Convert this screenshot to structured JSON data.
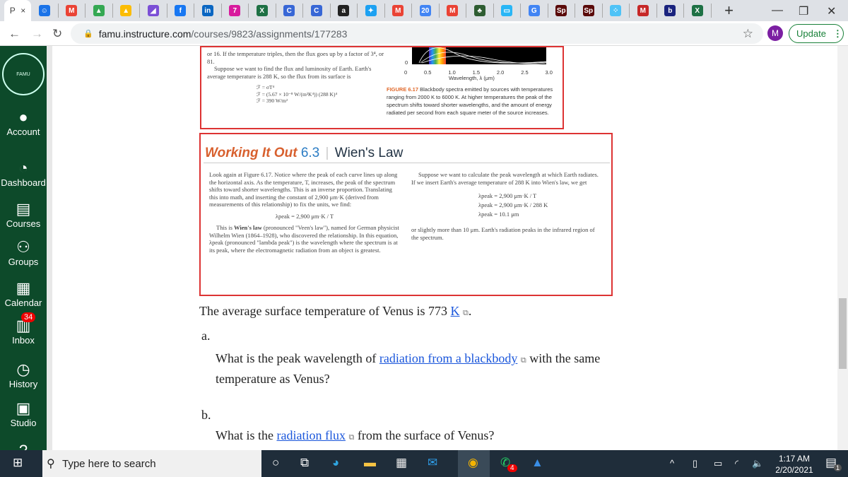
{
  "browser": {
    "active_tab": {
      "label": "P",
      "close": "×"
    },
    "tab_favicons": [
      {
        "icon": "meet-icon",
        "glyph": "☺",
        "color": "#1a73e8"
      },
      {
        "icon": "gmail-icon",
        "glyph": "M",
        "color": "#ea4335"
      },
      {
        "icon": "drive-icon",
        "glyph": "▲",
        "color": "#34a853"
      },
      {
        "icon": "drive-icon",
        "glyph": "▲",
        "color": "#fbbc04"
      },
      {
        "icon": "app-icon",
        "glyph": "◢",
        "color": "#7b4fd6"
      },
      {
        "icon": "facebook-icon",
        "glyph": "f",
        "color": "#1877f2"
      },
      {
        "icon": "linkedin-icon",
        "glyph": "in",
        "color": "#0a66c2"
      },
      {
        "icon": "calendar-icon",
        "glyph": "7",
        "color": "#d81b9d"
      },
      {
        "icon": "excel-icon",
        "glyph": "X",
        "color": "#1e7145"
      },
      {
        "icon": "c-icon",
        "glyph": "C",
        "color": "#3867d6"
      },
      {
        "icon": "c-icon",
        "glyph": "C",
        "color": "#3867d6"
      },
      {
        "icon": "amazon-icon",
        "glyph": "a",
        "color": "#222"
      },
      {
        "icon": "twitter-icon",
        "glyph": "✦",
        "color": "#1da1f2"
      },
      {
        "icon": "gmail-icon",
        "glyph": "M",
        "color": "#ea4335"
      },
      {
        "icon": "google-calendar-icon",
        "glyph": "20",
        "color": "#4285f4"
      },
      {
        "icon": "gmail-icon",
        "glyph": "M",
        "color": "#ea4335"
      },
      {
        "icon": "plant-icon",
        "glyph": "♣",
        "color": "#2e5d32"
      },
      {
        "icon": "app-icon",
        "glyph": "▭",
        "color": "#29b6f6"
      },
      {
        "icon": "google-icon",
        "glyph": "G",
        "color": "#4285f4"
      },
      {
        "icon": "adobe-spark-icon",
        "glyph": "Sp",
        "color": "#5a0a0a"
      },
      {
        "icon": "adobe-spark-icon",
        "glyph": "Sp",
        "color": "#5a0a0a"
      },
      {
        "icon": "dots-icon",
        "glyph": "⁘",
        "color": "#4fc3f7"
      },
      {
        "icon": "mcgraw-icon",
        "glyph": "M",
        "color": "#c62828"
      },
      {
        "icon": "b-icon",
        "glyph": "b",
        "color": "#1a237e"
      },
      {
        "icon": "excel-icon",
        "glyph": "X",
        "color": "#1e7145"
      }
    ],
    "new_tab": "+",
    "url_host": "famu.instructure.com",
    "url_path": "/courses/9823/assignments/177283",
    "profile_initial": "M",
    "update_label": "Update"
  },
  "sidebar": {
    "logo_text": "FAMU",
    "items": [
      {
        "label": "Account",
        "icon": "account-icon",
        "glyph": "●"
      },
      {
        "label": "Dashboard",
        "icon": "dashboard-icon",
        "glyph": "◔"
      },
      {
        "label": "Courses",
        "icon": "courses-icon",
        "glyph": "▤"
      },
      {
        "label": "Groups",
        "icon": "groups-icon",
        "glyph": "⚇"
      },
      {
        "label": "Calendar",
        "icon": "calendar-icon",
        "glyph": "▦"
      },
      {
        "label": "Inbox",
        "icon": "inbox-icon",
        "glyph": "▥",
        "badge": "34"
      },
      {
        "label": "History",
        "icon": "history-icon",
        "glyph": "◷"
      },
      {
        "label": "Studio",
        "icon": "studio-icon",
        "glyph": "▣"
      },
      {
        "label": "",
        "icon": "help-icon",
        "glyph": "?"
      }
    ]
  },
  "figure_top": {
    "text1": "or 16. If the temperature triples, then the flux goes up by a factor of 3⁴, or 81.",
    "text2": "Suppose we want to find the flux and luminosity of Earth. Earth's average temperature is 288 K, so the flux from its surface is",
    "eq1": "ℱ = σT⁴",
    "eq2": "ℱ = (5.67 × 10⁻⁸ W/(m²K⁴)) (288 K)⁴",
    "eq3": "ℱ = 390 W/m²",
    "y_zero": "0",
    "x_ticks": [
      "0",
      "0.5",
      "1.0",
      "1.5",
      "2.0",
      "2.5",
      "3.0"
    ],
    "x_label": "Wavelength, λ (μm)",
    "caption_label": "FIGURE 6.17",
    "caption": "Blackbody spectra emitted by sources with temperatures ranging from 2000 K to 6000 K. At higher temperatures the peak of the spectrum shifts toward shorter wavelengths, and the amount of energy radiated per second from each square meter of the source increases."
  },
  "working_it_out": {
    "label": "Working It Out",
    "number": "6.3",
    "title": "Wien's Law",
    "left_p1": "Look again at Figure 6.17. Notice where the peak of each curve lines up along the horizontal axis. As the temperature, T, increases, the peak of the spectrum shifts toward shorter wavelengths. This is an inverse proportion. Translating this into math, and inserting the constant of 2,900 μm·K (derived from measurements of this relationship) to fix the units, we find:",
    "left_eq": "λpeak = 2,900 μm·K / T",
    "left_p2_bold": "Wien's law",
    "left_p2_pre": "This is ",
    "left_p2": " (pronounced \"Veen's law\"), named for German physicist Wilhelm Wien (1864–1928), who discovered the relationship. In this equation, λpeak (pronounced \"lambda peak\") is the wavelength where the spectrum is at its peak, where the electromagnetic radiation from an object is greatest.",
    "right_p1": "Suppose we want to calculate the peak wavelength at which Earth radiates. If we insert Earth's average temperature of 288 K into Wien's law, we get",
    "right_eq1": "λpeak = 2,900 μm·K / T",
    "right_eq2": "λpeak = 2,900 μm·K / 288 K",
    "right_eq3": "λpeak = 10.1 μm",
    "right_p2": "or slightly more than 10 μm. Earth's radiation peaks in the infrared region of the spectrum."
  },
  "question": {
    "intro_pre": "The average surface temperature of Venus is 773 ",
    "intro_link": "K",
    "intro_post": ".",
    "a_label": "a.",
    "a_pre": "What is the peak wavelength of ",
    "a_link": "radiation from a blackbody",
    "a_post": " with the same temperature as Venus?",
    "b_label": "b.",
    "b_pre": "What is the ",
    "b_link": "radiation flux",
    "b_post": " from the surface of Venus?"
  },
  "taskbar": {
    "search_placeholder": "Type here to search",
    "whatsapp_badge": "4",
    "time": "1:17 AM",
    "date": "2/20/2021",
    "notifications": "1"
  }
}
